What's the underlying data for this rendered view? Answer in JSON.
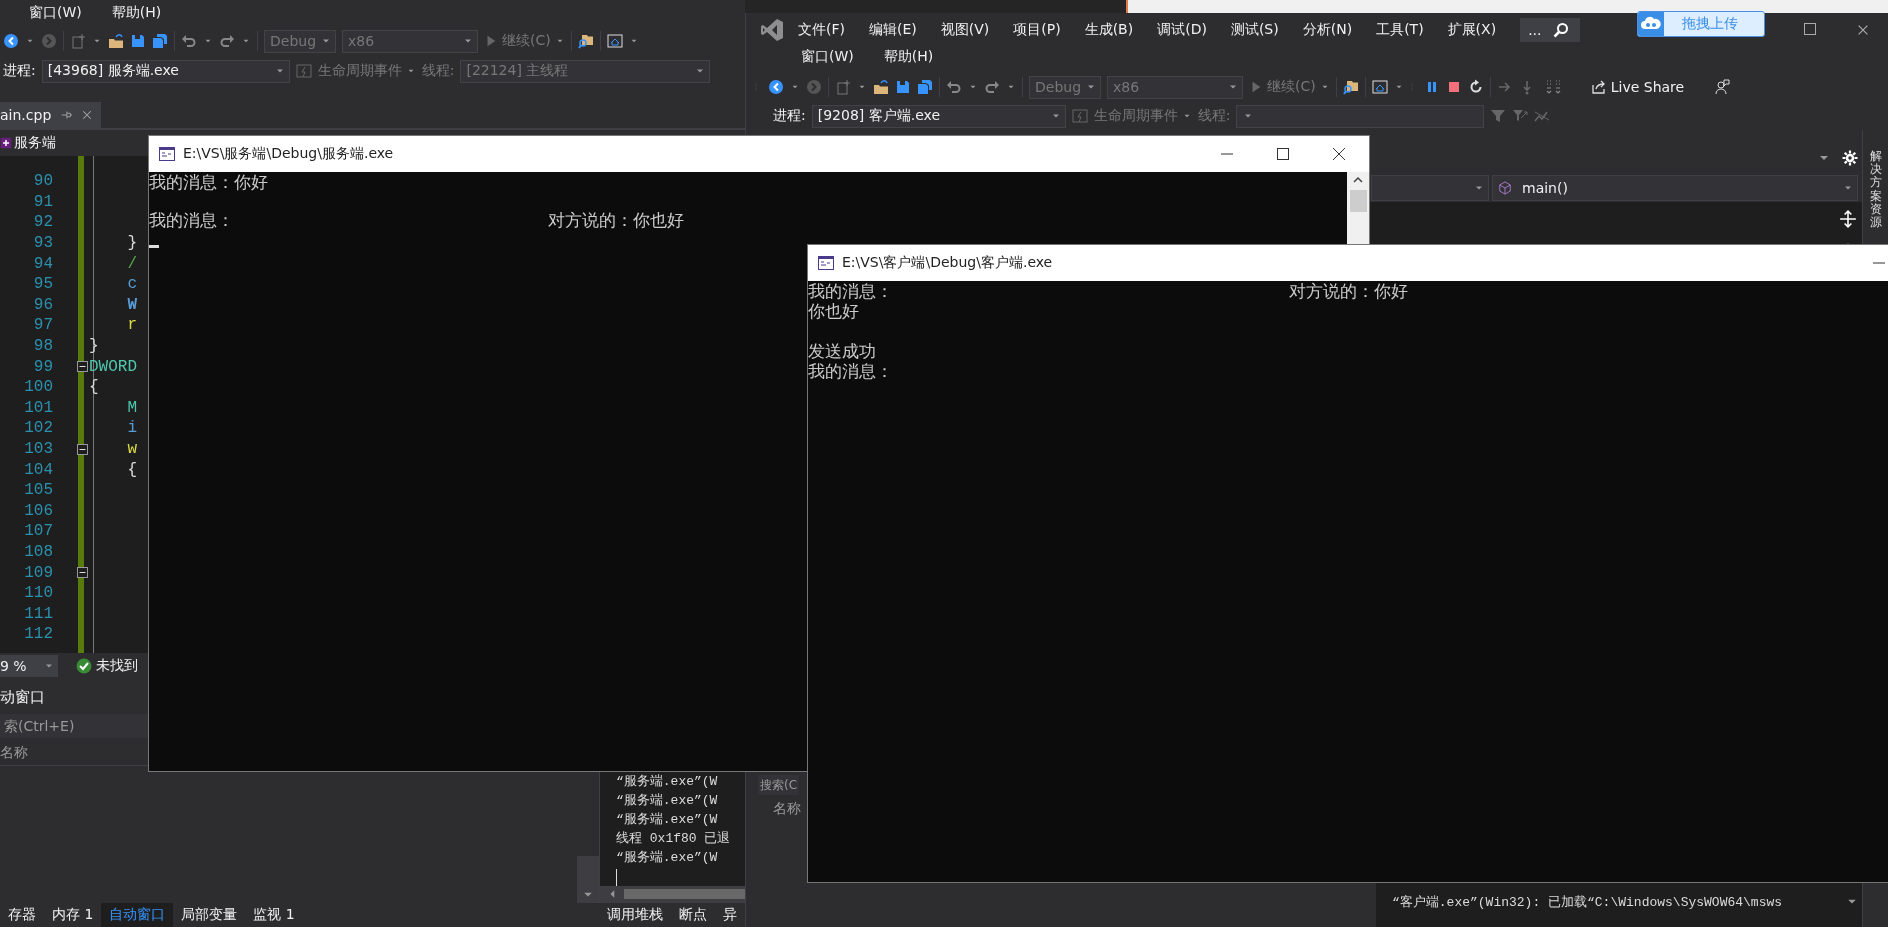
{
  "server_ide": {
    "menu": [
      "窗口(W)",
      "帮助(H)"
    ],
    "toolbar": {
      "configuration": "Debug",
      "platform": "x86",
      "continue": "继续(C)"
    },
    "debug_location": {
      "process_label": "进程:",
      "process": "[43968] 服务端.exe",
      "lifecycle_events": "生命周期事件",
      "thread_label": "线程:",
      "thread": "[22124] 主线程"
    },
    "tab": "ain.cpp",
    "project": "服务端",
    "code_lines": [
      {
        "number": "90",
        "fold": false
      },
      {
        "number": "91",
        "fold": false
      },
      {
        "number": "92",
        "fold": false
      },
      {
        "number": "93",
        "text": "    }",
        "kind": "plain",
        "fold": false
      },
      {
        "number": "94",
        "text": "    /",
        "kind": "comment",
        "fold": false
      },
      {
        "number": "95",
        "text": "    c",
        "kind": "keyword",
        "fold": false
      },
      {
        "number": "96",
        "text": "    W",
        "kind": "keyword",
        "fold": false
      },
      {
        "number": "97",
        "text": "    r",
        "kind": "control",
        "fold": false
      },
      {
        "number": "98",
        "text": "}",
        "kind": "plain",
        "fold": false
      },
      {
        "number": "99",
        "text": "DWORD",
        "kind": "type",
        "fold": true
      },
      {
        "number": "100",
        "text": "{",
        "kind": "plain",
        "fold": false
      },
      {
        "number": "101",
        "text": "    M",
        "kind": "type",
        "fold": false
      },
      {
        "number": "102",
        "text": "    i",
        "kind": "keyword",
        "fold": false
      },
      {
        "number": "103",
        "text": "    w",
        "kind": "control",
        "fold": true
      },
      {
        "number": "104",
        "text": "    {",
        "kind": "plain",
        "fold": false
      },
      {
        "number": "105",
        "fold": false
      },
      {
        "number": "106",
        "fold": false
      },
      {
        "number": "107",
        "fold": false
      },
      {
        "number": "108",
        "fold": false
      },
      {
        "number": "109",
        "fold": true
      },
      {
        "number": "110",
        "fold": false
      },
      {
        "number": "111",
        "fold": false
      },
      {
        "number": "112",
        "fold": false
      }
    ],
    "zoom": "9 %",
    "issues": "未找到",
    "autos": {
      "title": "动窗口",
      "search_placeholder": "索(Ctrl+E)",
      "column": "名称"
    },
    "output_lines": [
      "“服务端.exe”(W",
      "“服务端.exe”(W",
      "“服务端.exe”(W",
      "线程 0x1f80 已退",
      "“服务端.exe”(W"
    ],
    "bottom_tabs": [
      {
        "label": "存器",
        "selected": false
      },
      {
        "label": "内存 1",
        "selected": false
      },
      {
        "label": "自动窗口",
        "selected": true
      },
      {
        "label": "局部变量",
        "selected": false
      },
      {
        "label": "监视 1",
        "selected": false
      }
    ],
    "output_tabs": [
      "调用堆栈",
      "断点",
      "异"
    ]
  },
  "client_ide": {
    "menu_rows": [
      [
        "文件(F)",
        "编辑(E)",
        "视图(V)",
        "项目(P)",
        "生成(B)",
        "调试(D)",
        "测试(S)",
        "分析(N)",
        "工具(T)",
        "扩展(X)"
      ],
      [
        "窗口(W)",
        "帮助(H)"
      ]
    ],
    "search": "...",
    "toolbar": {
      "configuration": "Debug",
      "platform": "x86",
      "continue": "继续(C)",
      "live_share": "Live Share"
    },
    "debug_location": {
      "process_label": "进程:",
      "process": "[9208] 客户端.exe",
      "lifecycle_events": "生命周期事件",
      "thread_label": "线程:"
    },
    "function": "main()",
    "side_tab": "解决方案资源",
    "autos": {
      "search_placeholder": "搜索(C",
      "column": "名称"
    },
    "output_lines": [
      "“客户端.exe”(Win32): 已加载“C:\\Windows\\SysWOW64\\msws"
    ]
  },
  "upload_badge": {
    "label": "拖拽上传"
  },
  "consoles": [
    {
      "title": "E:\\VS\\服务端\\Debug\\服务端.exe",
      "lines": [
        {
          "text": "我的消息：你好",
          "blank_line_before": false
        },
        {
          "text": "我的消息：",
          "reply": "对方说的：你也好",
          "blank_line_before": true
        }
      ],
      "cursor": true
    },
    {
      "title": "E:\\VS\\客户端\\Debug\\客户端.exe",
      "lines": [
        {
          "text": "我的消息：",
          "reply": "对方说的：你好",
          "blank_line_before": false
        },
        {
          "text": "你也好",
          "blank_line_before": false
        },
        {
          "text": "发送成功",
          "blank_line_before": true
        },
        {
          "text": "我的消息：",
          "blank_line_before": false
        }
      ],
      "cursor": false
    }
  ]
}
